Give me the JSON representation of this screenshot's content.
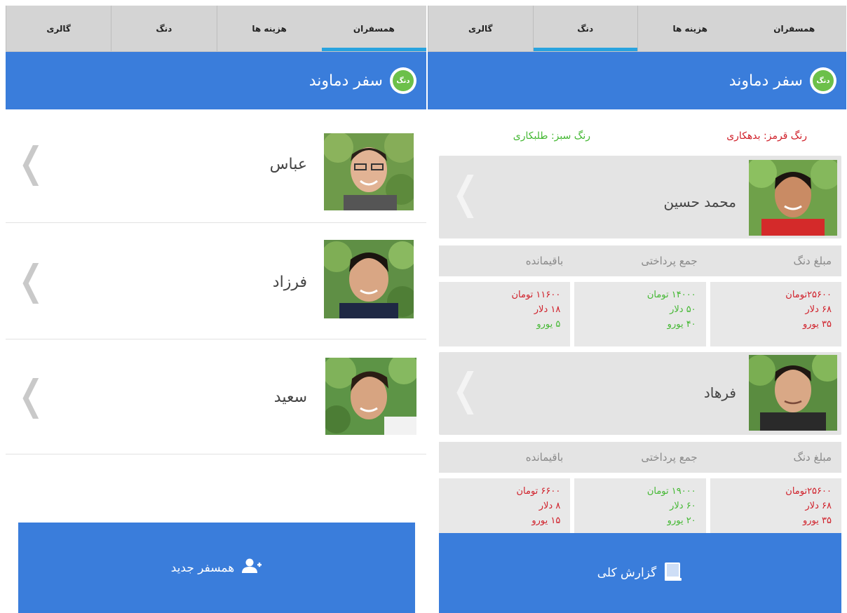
{
  "left": {
    "tabs": [
      {
        "label": "همسفران",
        "active": true
      },
      {
        "label": "هزینه ها",
        "active": false
      },
      {
        "label": "دنگ",
        "active": false
      },
      {
        "label": "گالری",
        "active": false
      }
    ],
    "title": "سفر دماوند",
    "logo_text": "دنگ",
    "members": [
      {
        "name": "عباس"
      },
      {
        "name": "فرزاد"
      },
      {
        "name": "سعید"
      }
    ],
    "new_member_button": "همسفر جدید"
  },
  "right": {
    "tabs": [
      {
        "label": "همسفران",
        "active": false
      },
      {
        "label": "هزینه ها",
        "active": false
      },
      {
        "label": "دنگ",
        "active": true
      },
      {
        "label": "گالری",
        "active": false
      }
    ],
    "title": "سفر دماوند",
    "logo_text": "دنگ",
    "legend_red": "رنگ قرمز: بدهکاری",
    "legend_green": "رنگ سبز: طلبکاری",
    "column_headers": [
      "مبلغ دنگ",
      "جمع پرداختی",
      "باقیمانده"
    ],
    "people": [
      {
        "name": "محمد حسین",
        "share": [
          "۲۵۶۰۰تومان",
          "۶۸ دلار",
          "۳۵ یورو"
        ],
        "paid": [
          "۱۴۰۰۰ تومان",
          "۵۰ دلار",
          "۴۰ یورو"
        ],
        "remaining": [
          "۱۱۶۰۰ تومان",
          "۱۸ دلار",
          "۵ یورو"
        ]
      },
      {
        "name": "فرهاد",
        "share": [
          "۲۵۶۰۰تومان",
          "۶۸ دلار",
          "۳۵ یورو"
        ],
        "paid": [
          "۱۹۰۰۰ تومان",
          "۶۰ دلار",
          "۲۰ یورو"
        ],
        "remaining": [
          "۶۶۰۰ تومان",
          "۸ دلار",
          "۱۵ یورو"
        ]
      }
    ],
    "report_button": "گزارش کلی"
  },
  "colors": {
    "accent_blue": "#3a7ddb",
    "tab_indicator": "#29a3df",
    "debt_red": "#d0202a",
    "credit_green": "#44b833"
  }
}
